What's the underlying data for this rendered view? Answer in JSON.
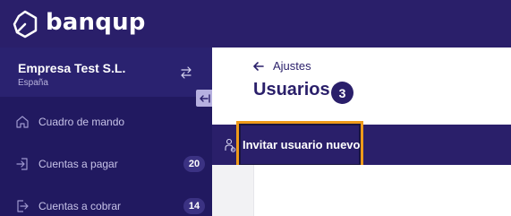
{
  "brand": {
    "name": "banqup",
    "logo_icon": "hexagon-leaf-logo"
  },
  "company": {
    "name": "Empresa Test S.L.",
    "country": "España"
  },
  "sidebar": {
    "items": [
      {
        "label": "Cuadro de mando",
        "icon": "home-icon",
        "badge": null
      },
      {
        "label": "Cuentas a pagar",
        "icon": "sign-in-icon",
        "badge": "20"
      },
      {
        "label": "Cuentas a cobrar",
        "icon": "sign-out-icon",
        "badge": "14"
      }
    ]
  },
  "main": {
    "back_label": "Ajustes",
    "title": "Usuarios",
    "count": "3",
    "invite_label": "Invitar usuario nuevo"
  },
  "colors": {
    "primary": "#2a1f6a",
    "highlight": "#ee9a1a"
  }
}
